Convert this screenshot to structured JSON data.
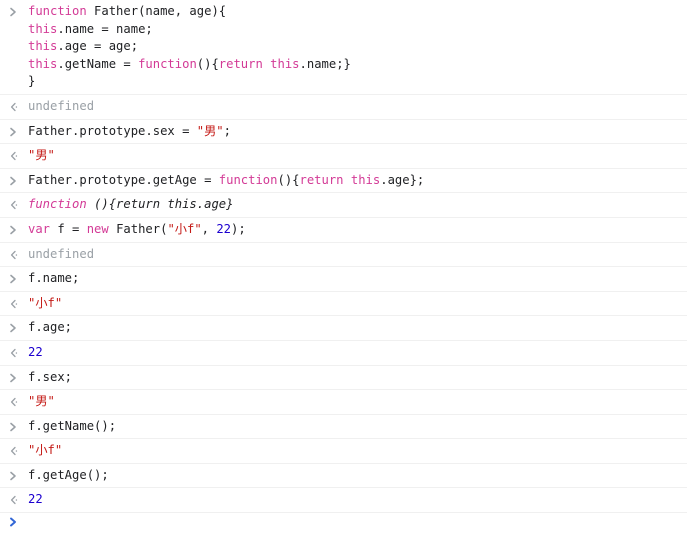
{
  "console": {
    "prompt_icon": "chevron-right-icon",
    "result_icon": "chevron-left-icon",
    "colors": {
      "keyword": "#d33a96",
      "string": "#c41a16",
      "number": "#1c00cf",
      "plain": "#202124",
      "muted": "#9aa0a6",
      "divider": "#f0f0f0",
      "background": "#ffffff",
      "active_prompt": "#3367d6"
    },
    "entries": [
      {
        "type": "input",
        "lines": [
          [
            {
              "t": "function ",
              "c": "kw"
            },
            {
              "t": "Father(name, age){",
              "c": "plain"
            }
          ],
          [
            {
              "t": "this",
              "c": "kw"
            },
            {
              "t": ".name = name;",
              "c": "plain"
            }
          ],
          [
            {
              "t": "this",
              "c": "kw"
            },
            {
              "t": ".age = age;",
              "c": "plain"
            }
          ],
          [
            {
              "t": "this",
              "c": "kw"
            },
            {
              "t": ".getName = ",
              "c": "plain"
            },
            {
              "t": "function",
              "c": "kw"
            },
            {
              "t": "(){",
              "c": "plain"
            },
            {
              "t": "return ",
              "c": "kw"
            },
            {
              "t": "this",
              "c": "kw"
            },
            {
              "t": ".name;}",
              "c": "plain"
            }
          ],
          [
            {
              "t": "}",
              "c": "plain"
            }
          ]
        ]
      },
      {
        "type": "output",
        "lines": [
          [
            {
              "t": "undefined",
              "c": "res-undef"
            }
          ]
        ]
      },
      {
        "type": "input",
        "lines": [
          [
            {
              "t": "Father.prototype.sex = ",
              "c": "plain"
            },
            {
              "t": "\"男\"",
              "c": "str"
            },
            {
              "t": ";",
              "c": "plain"
            }
          ]
        ]
      },
      {
        "type": "output",
        "lines": [
          [
            {
              "t": "\"男\"",
              "c": "str"
            }
          ]
        ]
      },
      {
        "type": "input",
        "lines": [
          [
            {
              "t": "Father.prototype.getAge = ",
              "c": "plain"
            },
            {
              "t": "function",
              "c": "kw"
            },
            {
              "t": "(){",
              "c": "plain"
            },
            {
              "t": "return ",
              "c": "kw"
            },
            {
              "t": "this",
              "c": "kw"
            },
            {
              "t": ".age};",
              "c": "plain"
            }
          ]
        ]
      },
      {
        "type": "output",
        "italic": true,
        "lines": [
          [
            {
              "t": "function ",
              "c": "kw"
            },
            {
              "t": "(){return this.age}",
              "c": "plain"
            }
          ]
        ]
      },
      {
        "type": "input",
        "lines": [
          [
            {
              "t": "var ",
              "c": "kw"
            },
            {
              "t": "f = ",
              "c": "plain"
            },
            {
              "t": "new ",
              "c": "kw"
            },
            {
              "t": "Father(",
              "c": "plain"
            },
            {
              "t": "\"小f\"",
              "c": "str"
            },
            {
              "t": ", ",
              "c": "plain"
            },
            {
              "t": "22",
              "c": "num"
            },
            {
              "t": ");",
              "c": "plain"
            }
          ]
        ]
      },
      {
        "type": "output",
        "lines": [
          [
            {
              "t": "undefined",
              "c": "res-undef"
            }
          ]
        ]
      },
      {
        "type": "input",
        "lines": [
          [
            {
              "t": "f.name;",
              "c": "plain"
            }
          ]
        ]
      },
      {
        "type": "output",
        "lines": [
          [
            {
              "t": "\"小f\"",
              "c": "str"
            }
          ]
        ]
      },
      {
        "type": "input",
        "lines": [
          [
            {
              "t": "f.age;",
              "c": "plain"
            }
          ]
        ]
      },
      {
        "type": "output",
        "lines": [
          [
            {
              "t": "22",
              "c": "num"
            }
          ]
        ]
      },
      {
        "type": "input",
        "lines": [
          [
            {
              "t": "f.sex;",
              "c": "plain"
            }
          ]
        ]
      },
      {
        "type": "output",
        "lines": [
          [
            {
              "t": "\"男\"",
              "c": "str"
            }
          ]
        ]
      },
      {
        "type": "input",
        "lines": [
          [
            {
              "t": "f.getName();",
              "c": "plain"
            }
          ]
        ]
      },
      {
        "type": "output",
        "lines": [
          [
            {
              "t": "\"小f\"",
              "c": "str"
            }
          ]
        ]
      },
      {
        "type": "input",
        "lines": [
          [
            {
              "t": "f.getAge();",
              "c": "plain"
            }
          ]
        ]
      },
      {
        "type": "output",
        "lines": [
          [
            {
              "t": "22",
              "c": "num"
            }
          ]
        ]
      }
    ],
    "active_input": {
      "icon": "chevron-right-icon",
      "value": "",
      "placeholder": ""
    }
  }
}
